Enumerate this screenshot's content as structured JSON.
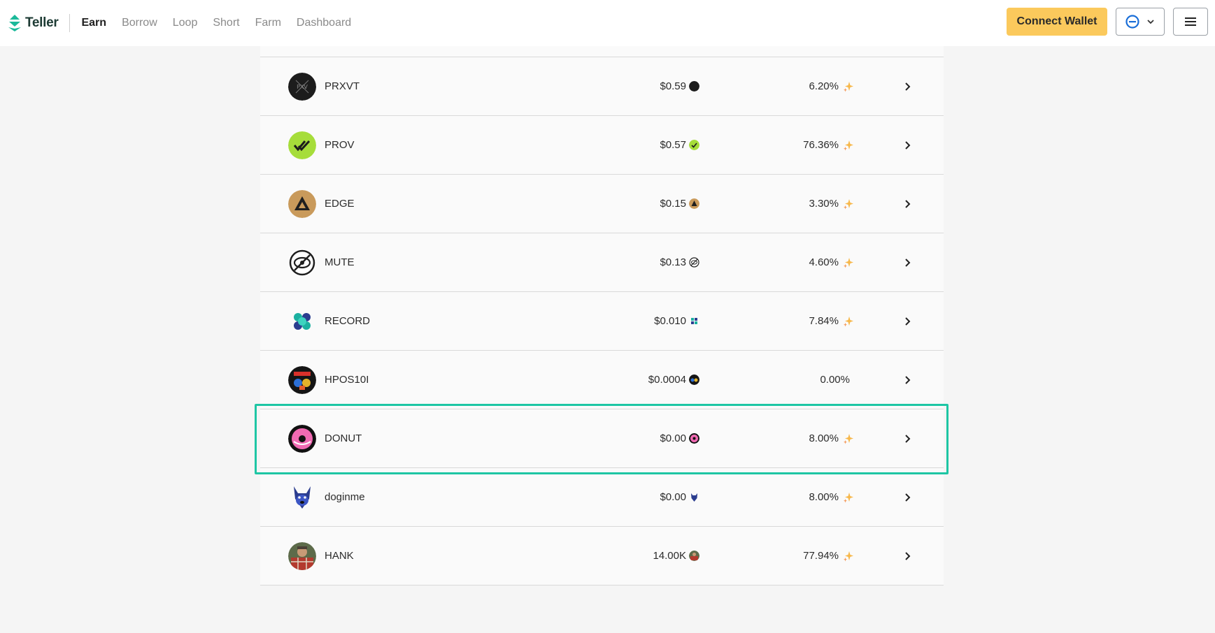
{
  "app": {
    "logo_text": "Teller"
  },
  "nav": {
    "items": [
      {
        "label": "Earn",
        "active": true
      },
      {
        "label": "Borrow",
        "active": false
      },
      {
        "label": "Loop",
        "active": false
      },
      {
        "label": "Short",
        "active": false
      },
      {
        "label": "Farm",
        "active": false
      },
      {
        "label": "Dashboard",
        "active": false
      }
    ]
  },
  "header": {
    "connect_label": "Connect Wallet",
    "network_icon": "network-circle-icon",
    "menu_icon": "hamburger-menu-icon"
  },
  "colors": {
    "accent_yellow": "#fbc95c",
    "highlight_teal": "#1ec6a4",
    "network_blue": "#1a6ed8"
  },
  "tokens": [
    {
      "name": "PRXVT",
      "price": "$0.59",
      "apy": "6.20%",
      "has_boost": true,
      "icon": "prxvt-icon"
    },
    {
      "name": "PROV",
      "price": "$0.57",
      "apy": "76.36%",
      "has_boost": true,
      "icon": "prov-icon"
    },
    {
      "name": "EDGE",
      "price": "$0.15",
      "apy": "3.30%",
      "has_boost": true,
      "icon": "edge-icon"
    },
    {
      "name": "MUTE",
      "price": "$0.13",
      "apy": "4.60%",
      "has_boost": true,
      "icon": "mute-icon"
    },
    {
      "name": "RECORD",
      "price": "$0.010",
      "apy": "7.84%",
      "has_boost": true,
      "icon": "record-icon"
    },
    {
      "name": "HPOS10I",
      "price": "$0.0004",
      "apy": "0.00%",
      "has_boost": false,
      "icon": "hpos10i-icon"
    },
    {
      "name": "DONUT",
      "price": "$0.00",
      "apy": "8.00%",
      "has_boost": true,
      "icon": "donut-icon",
      "highlighted": true
    },
    {
      "name": "doginme",
      "price": "$0.00",
      "apy": "8.00%",
      "has_boost": true,
      "icon": "doginme-icon"
    },
    {
      "name": "HANK",
      "price": "14.00K",
      "apy": "77.94%",
      "has_boost": true,
      "icon": "hank-icon"
    }
  ]
}
